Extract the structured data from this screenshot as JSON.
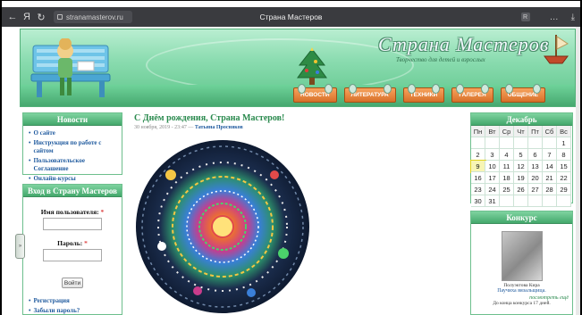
{
  "browser": {
    "url": "stranamasterov.ru",
    "tab_title": "Страна Мастеров",
    "yandex_label": "Я",
    "reader_label": "R"
  },
  "header": {
    "site_title": "Страна Мастеров",
    "subtitle": "Творчество для детей и взрослых",
    "nav": [
      {
        "label": "НОВОСТИ"
      },
      {
        "label": "ЛИТЕРАТУРА"
      },
      {
        "label": "ТЕХНИКИ"
      },
      {
        "label": "ГАЛЕРЕЯ"
      },
      {
        "label": "ОБЩЕНИЕ"
      }
    ]
  },
  "news_panel": {
    "title": "Новости",
    "items": [
      "О сайте",
      "Инструкция по работе с сайтом",
      "Пользовательское Соглашение",
      "Онлайн-курсы"
    ]
  },
  "login_panel": {
    "title": "Вход в Страну Мастеров",
    "username_label": "Имя пользователя:",
    "password_label": "Пароль:",
    "required_mark": "*",
    "submit_label": "Войти",
    "links": [
      "Регистрация",
      "Забыли пароль?"
    ]
  },
  "article": {
    "title": "С Днём рождения, Страна Мастеров!",
    "date": "30 ноября, 2019 - 23:47 —",
    "author": "Татьяна Просняков"
  },
  "calendar": {
    "title": "Декабрь",
    "weekdays": [
      "Пн",
      "Вт",
      "Ср",
      "Чт",
      "Пт",
      "Сб",
      "Вс"
    ],
    "weeks": [
      [
        "",
        "",
        "",
        "",
        "",
        "",
        "1"
      ],
      [
        "2",
        "3",
        "4",
        "5",
        "6",
        "7",
        "8"
      ],
      [
        "9",
        "10",
        "11",
        "12",
        "13",
        "14",
        "15"
      ],
      [
        "16",
        "17",
        "18",
        "19",
        "20",
        "21",
        "22"
      ],
      [
        "23",
        "24",
        "25",
        "26",
        "27",
        "28",
        "29"
      ],
      [
        "30",
        "31",
        "",
        "",
        "",
        "",
        ""
      ]
    ],
    "today": "9"
  },
  "contest_panel": {
    "title": "Конкурс",
    "author": "Полуэктова Кира",
    "work_name": "Паучиха вязальщица.",
    "more_link": "посмотреть ещё",
    "note": "До конца конкурса 17 дней."
  },
  "side_tab_label": "»"
}
